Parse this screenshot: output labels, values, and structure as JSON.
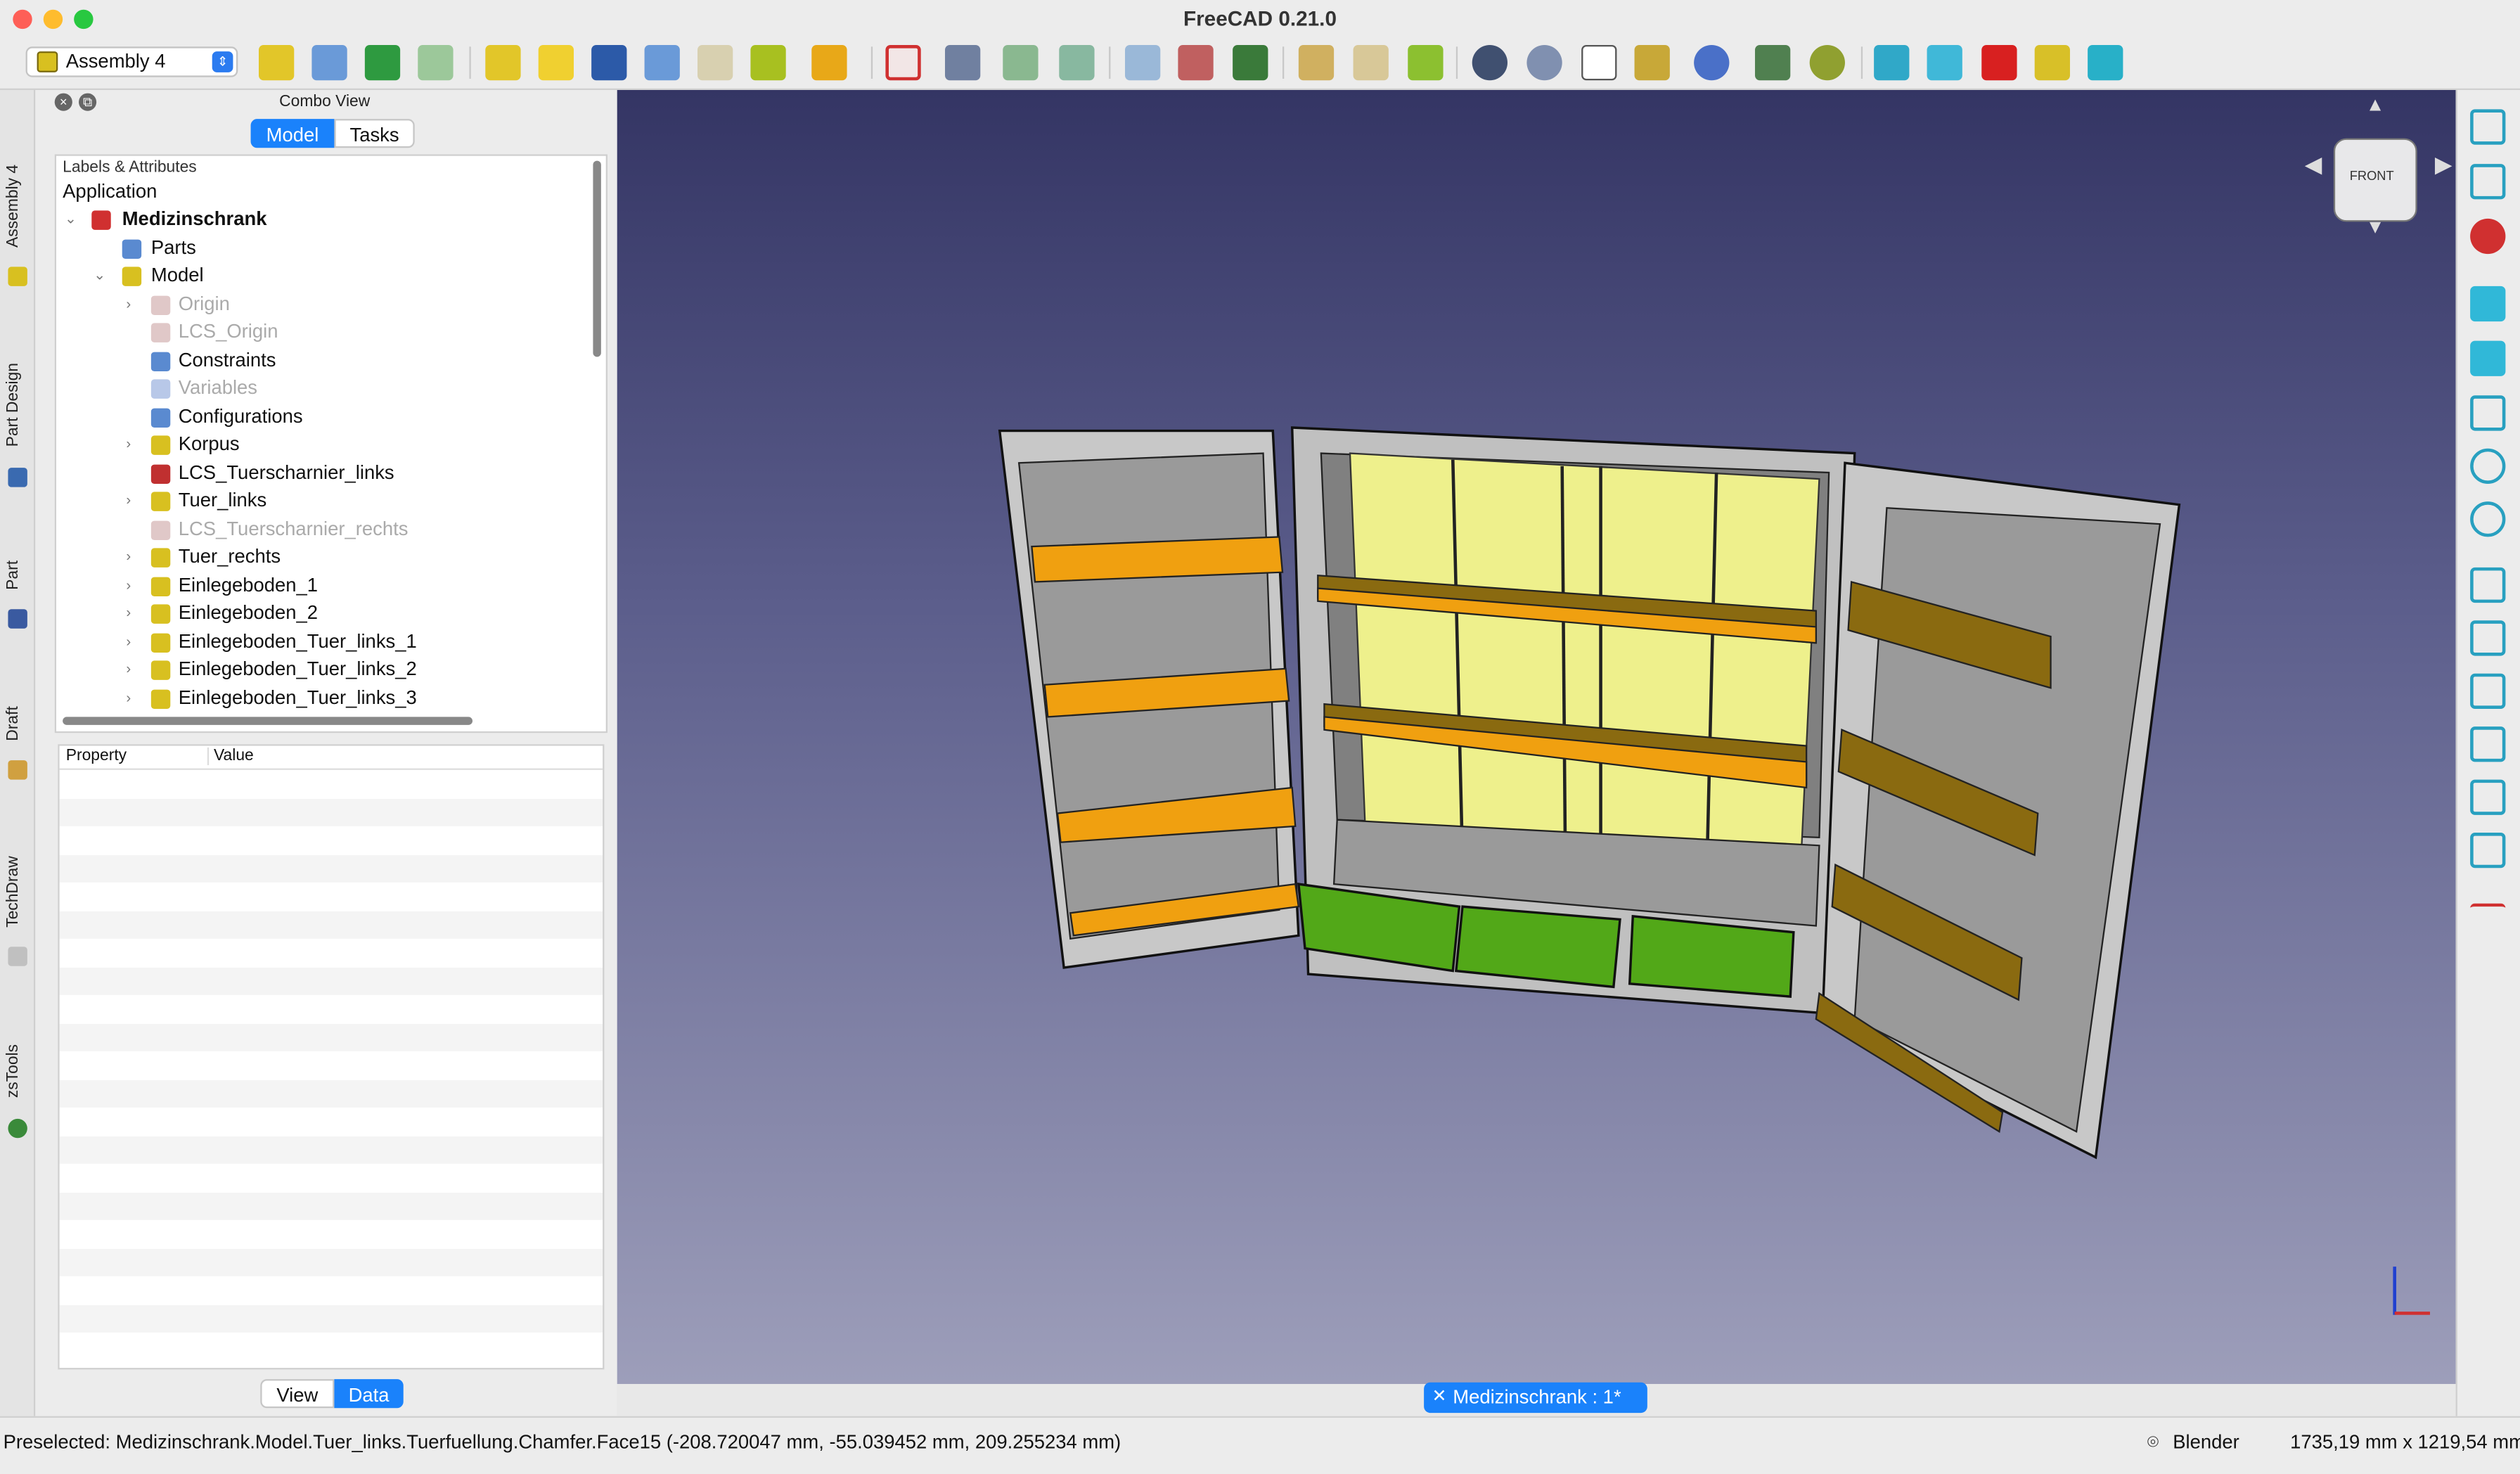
{
  "window": {
    "title": "FreeCAD 0.21.0"
  },
  "toolbar": {
    "workbench": "Assembly 4"
  },
  "lefttabs": [
    "Assembly 4",
    "Part Design",
    "Part",
    "Draft",
    "TechDraw",
    "zsTools"
  ],
  "combo": {
    "title": "Combo View",
    "tabs": [
      "Model",
      "Tasks"
    ],
    "tree_header": "Labels & Attributes",
    "tree": [
      {
        "label": "Application"
      },
      {
        "label": "Medizinschrank"
      },
      {
        "label": "Parts"
      },
      {
        "label": "Model"
      },
      {
        "label": "Origin"
      },
      {
        "label": "LCS_Origin"
      },
      {
        "label": "Constraints"
      },
      {
        "label": "Variables"
      },
      {
        "label": "Configurations"
      },
      {
        "label": "Korpus"
      },
      {
        "label": "LCS_Tuerscharnier_links"
      },
      {
        "label": "Tuer_links"
      },
      {
        "label": "LCS_Tuerscharnier_rechts"
      },
      {
        "label": "Tuer_rechts"
      },
      {
        "label": "Einlegeboden_1"
      },
      {
        "label": "Einlegeboden_2"
      },
      {
        "label": "Einlegeboden_Tuer_links_1"
      },
      {
        "label": "Einlegeboden_Tuer_links_2"
      },
      {
        "label": "Einlegeboden_Tuer_links_3"
      }
    ],
    "prop_headers": [
      "Property",
      "Value"
    ],
    "bottom_tabs": [
      "View",
      "Data"
    ]
  },
  "navcube": {
    "face": "FRONT"
  },
  "doc_tab": "Medizinschrank : 1*",
  "status": {
    "message": "Preselected: Medizinschrank.Model.Tuer_links.Tuerfuellung.Chamfer.Face15 (-208.720047 mm, -55.039452 mm, 209.255234 mm)",
    "nav_style": "Blender",
    "dimensions": "1735,19 mm x 1219,54 mm"
  },
  "colors": {
    "accent": "#1a82fb",
    "shelf_orange": "#f0a010",
    "drawer_green": "#52a818",
    "back_yellow": "#eef08c"
  }
}
